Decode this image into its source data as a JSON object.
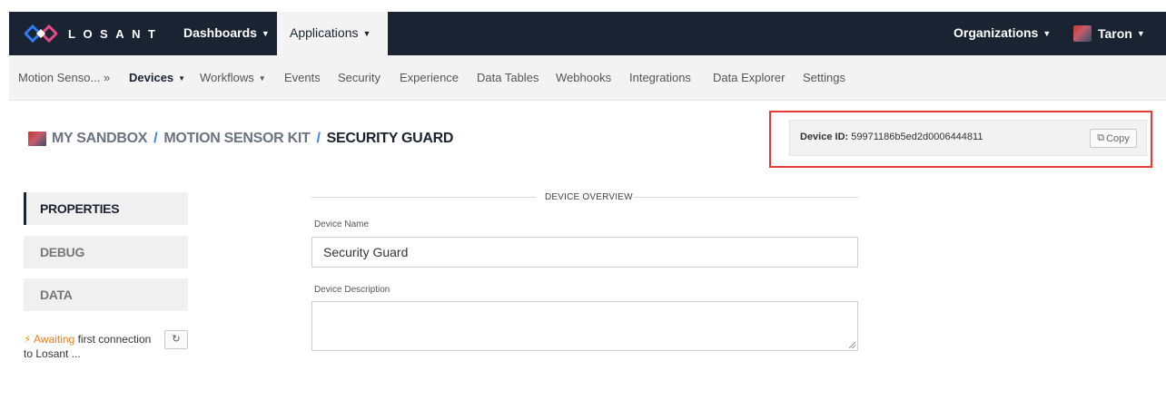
{
  "brand": {
    "name": "LOSANT",
    "color_primary": "#1a2332",
    "color_accent": "#3b82f6"
  },
  "topnav": {
    "dashboards": "Dashboards",
    "applications": "Applications",
    "organizations": "Organizations",
    "user": "Taron"
  },
  "subnav": {
    "app_short": "Motion Senso... »",
    "devices": "Devices",
    "workflows": "Workflows",
    "events": "Events",
    "security": "Security",
    "experience": "Experience",
    "data_tables": "Data Tables",
    "webhooks": "Webhooks",
    "integrations": "Integrations",
    "data_explorer": "Data Explorer",
    "settings": "Settings"
  },
  "breadcrumb": {
    "sandbox": "MY SANDBOX",
    "app": "MOTION SENSOR KIT",
    "device": "SECURITY GUARD",
    "separator": "/"
  },
  "device_id": {
    "label": "Device ID:",
    "value": "59971186b5ed2d0006444811",
    "copy_label": "Copy"
  },
  "tabs": {
    "properties": "PROPERTIES",
    "debug": "DEBUG",
    "data": "DATA"
  },
  "status": {
    "awaiting": "Awaiting",
    "rest": "first connection to Losant ..."
  },
  "form": {
    "section_title": "DEVICE OVERVIEW",
    "name_label": "Device Name",
    "name_value": "Security Guard",
    "description_label": "Device Description",
    "description_value": ""
  },
  "icons": {
    "logo": "losant-logo-icon",
    "caret": "caret-down-icon",
    "copy": "copy-icon",
    "refresh": "refresh-icon",
    "plug": "plug-icon"
  }
}
